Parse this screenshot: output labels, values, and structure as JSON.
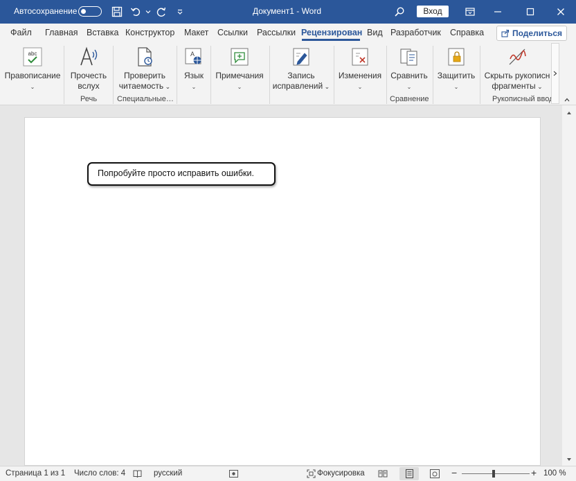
{
  "titlebar": {
    "autosave_label": "Автосохранение",
    "doc_title": "Документ1  -  Word",
    "login_label": "Вход"
  },
  "tabs": [
    "Файл",
    "Главная",
    "Вставка",
    "Конструктор",
    "Макет",
    "Ссылки",
    "Рассылки",
    "Рецензирован",
    "Вид",
    "Разработчик",
    "Справка"
  ],
  "active_tab": "Рецензирован",
  "share_label": "Поделиться",
  "ribbon": {
    "buttons": {
      "spelling": "Правописание",
      "read_aloud_1": "Прочесть",
      "read_aloud_2": "вслух",
      "check_read_1": "Проверить",
      "check_read_2": "читаемость",
      "language": "Язык",
      "comments": "Примечания",
      "track_1": "Запись",
      "track_2": "исправлений",
      "changes": "Изменения",
      "compare": "Сравнить",
      "protect": "Защитить",
      "ink_1": "Скрыть рукописн",
      "ink_2": "фрагменты"
    },
    "groups": {
      "speech": "Речь",
      "special": "Специальные…",
      "compare": "Сравнение",
      "ink": "Рукописный ввод"
    }
  },
  "document": {
    "text": "Попробуйте просто исправить ошибки."
  },
  "status": {
    "page": "Страница 1 из 1",
    "words": "Число слов: 4",
    "language": "русский",
    "focus": "Фокусировка",
    "zoom": "100 %"
  },
  "colors": {
    "accent": "#2b579a"
  }
}
